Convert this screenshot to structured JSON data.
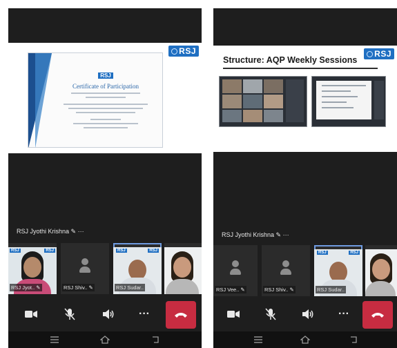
{
  "left": {
    "slide": {
      "brand": "RSJ",
      "certificate": {
        "logo": "RSJ",
        "title": "Certificate of Participation"
      }
    },
    "participant_label": "RSJ Jyothi Krishna ✎  ···",
    "thumbnails": [
      {
        "name": "RSJ Jyot.. ✎",
        "type": "video"
      },
      {
        "name": "RSJ Shiv.. ✎",
        "type": "avatar"
      },
      {
        "name": "RSJ Sudar..",
        "type": "video",
        "active": true
      },
      {
        "name": "",
        "type": "video"
      }
    ]
  },
  "right": {
    "slide": {
      "brand": "RSJ",
      "title": "Structure: AQP Weekly Sessions"
    },
    "participant_label": "RSJ Jyothi Krishna ✎  ···",
    "thumbnails": [
      {
        "name": "RSJ Vee.. ✎",
        "type": "avatar"
      },
      {
        "name": "RSJ Shiv.. ✎",
        "type": "avatar"
      },
      {
        "name": "RSJ Sudar..",
        "type": "video",
        "active": true
      },
      {
        "name": "",
        "type": "video"
      }
    ]
  },
  "controls": {
    "icons": [
      "video-camera-icon",
      "mic-muted-icon",
      "speaker-icon",
      "more-icon",
      "hang-up-icon"
    ],
    "more_label": "···"
  },
  "system_nav": {
    "icons": [
      "recents-icon",
      "home-icon",
      "back-icon"
    ]
  },
  "colors": {
    "hangup": "#c72c41",
    "brand": "#1f6fc2",
    "active_outline": "#6f9be0",
    "background": "#1e1e1e"
  }
}
